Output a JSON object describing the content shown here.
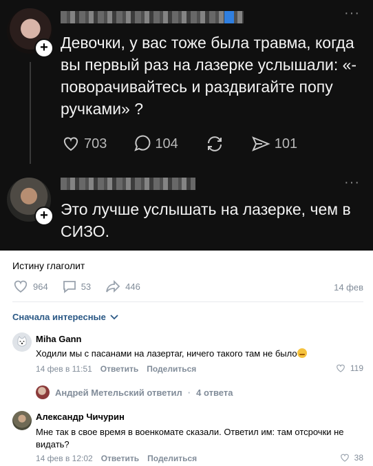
{
  "threads": {
    "post1": {
      "text": "Девочки, у вас тоже была травма, когда вы первый раз на лазерке услышали: «- поворачивайтесь и раздвигайте попу ручками» ?",
      "likes": "703",
      "comments": "104",
      "reposts": "",
      "shares": "101",
      "more": "···"
    },
    "post2": {
      "text": "Это лучше услышать на лазерке, чем в СИЗО.",
      "more": "···"
    },
    "plus": "+"
  },
  "vk": {
    "caption": "Истину глаголит",
    "likes": "964",
    "comments": "53",
    "shares": "446",
    "date": "14 фев",
    "sort_label": "Сначала интересные",
    "comments_list": [
      {
        "author": "Miha Gann",
        "text": "Ходили мы с пасанами на лазертаг, ничего такого там не было",
        "date": "14 фев в 11:51",
        "reply": "Ответить",
        "share": "Поделиться",
        "likes": "119"
      },
      {
        "author": "Александр Чичурин",
        "text": "Мне так в свое время в военкомате сказали. Ответил им: там отсрочки не видать?",
        "date": "14 фев в 12:02",
        "reply": "Ответить",
        "share": "Поделиться",
        "likes": "38"
      }
    ],
    "replies": {
      "author": "Андрей Метельский ответил",
      "count": "4 ответа"
    }
  }
}
